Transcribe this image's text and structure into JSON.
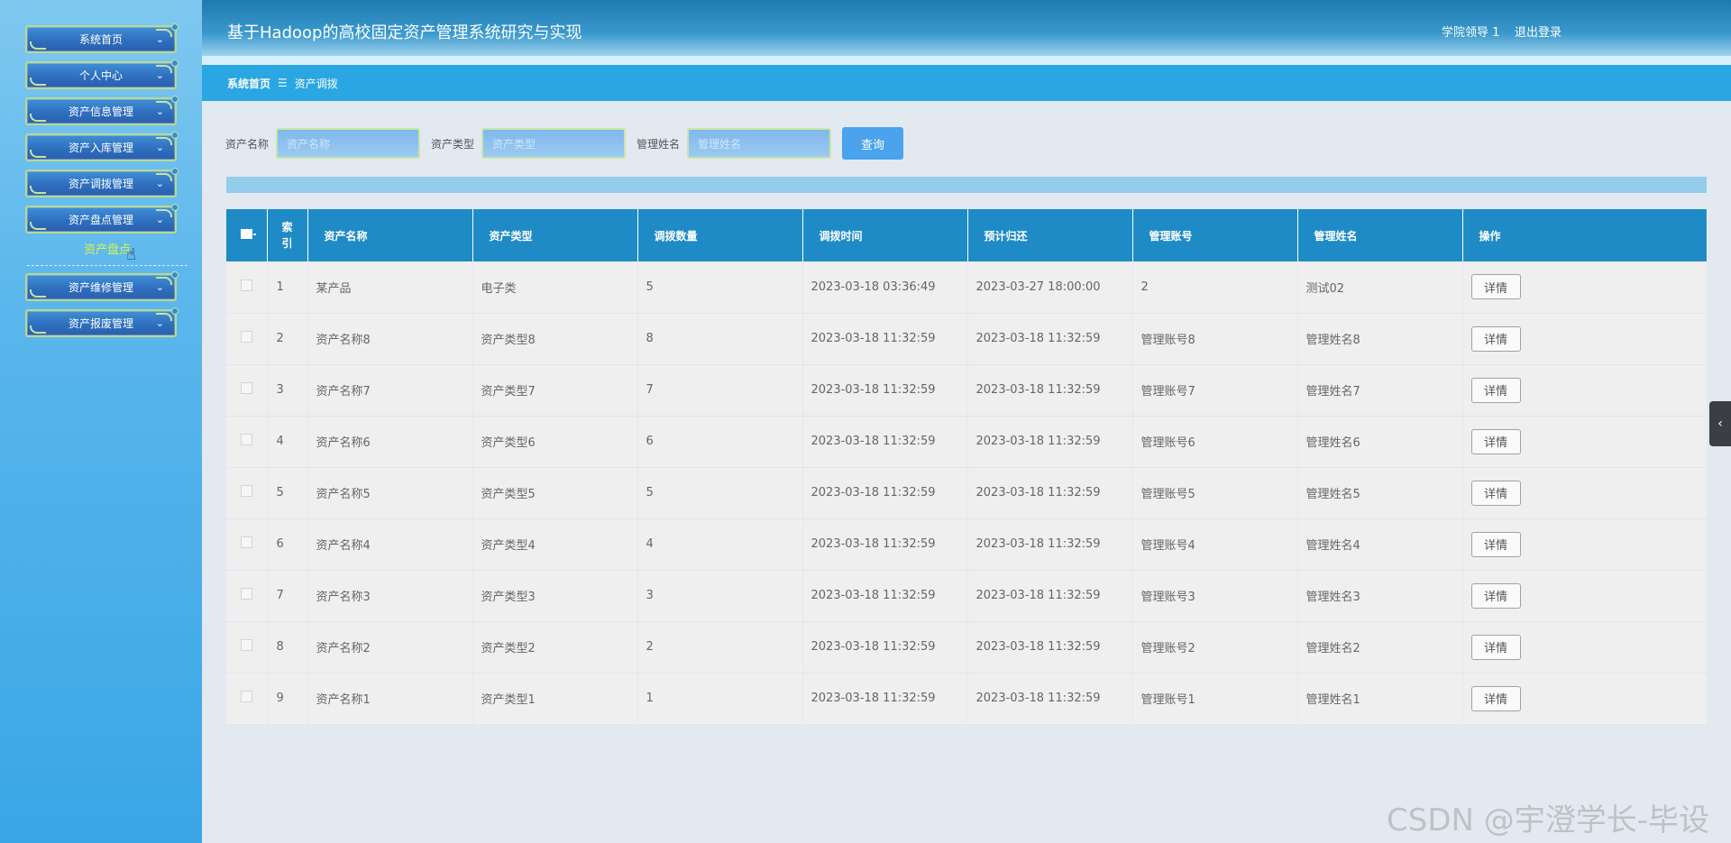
{
  "sidebar": {
    "items": [
      {
        "label": "系统首页"
      },
      {
        "label": "个人中心"
      },
      {
        "label": "资产信息管理"
      },
      {
        "label": "资产入库管理"
      },
      {
        "label": "资产调拨管理"
      },
      {
        "label": "资产盘点管理"
      },
      {
        "label": "资产维修管理"
      },
      {
        "label": "资产报废管理"
      }
    ],
    "submenu_label": "资产盘点",
    "chevron": "⌄",
    "cursor_icon": "☝"
  },
  "header": {
    "title": "基于Hadoop的高校固定资产管理系统研究与实现",
    "user": "学院领导 1",
    "logout": "退出登录"
  },
  "breadcrumb": {
    "home": "系统首页",
    "separator": "☰",
    "current": "资产调拨"
  },
  "search": {
    "asset_name_label": "资产名称",
    "asset_name_placeholder": "资产名称",
    "asset_type_label": "资产类型",
    "asset_type_placeholder": "资产类型",
    "manager_name_label": "管理姓名",
    "manager_name_placeholder": "管理姓名",
    "query_button": "查询"
  },
  "table": {
    "columns": [
      "索引",
      "资产名称",
      "资产类型",
      "调拨数量",
      "调拨时间",
      "预计归还",
      "管理账号",
      "管理姓名",
      "操作"
    ],
    "index_header_line1": "索",
    "index_header_line2": "引",
    "detail_label": "详情",
    "rows": [
      [
        "1",
        "某产品",
        "电子类",
        "5",
        "2023-03-18 03:36:49",
        "2023-03-27 18:00:00",
        "2",
        "测试02"
      ],
      [
        "2",
        "资产名称8",
        "资产类型8",
        "8",
        "2023-03-18 11:32:59",
        "2023-03-18 11:32:59",
        "管理账号8",
        "管理姓名8"
      ],
      [
        "3",
        "资产名称7",
        "资产类型7",
        "7",
        "2023-03-18 11:32:59",
        "2023-03-18 11:32:59",
        "管理账号7",
        "管理姓名7"
      ],
      [
        "4",
        "资产名称6",
        "资产类型6",
        "6",
        "2023-03-18 11:32:59",
        "2023-03-18 11:32:59",
        "管理账号6",
        "管理姓名6"
      ],
      [
        "5",
        "资产名称5",
        "资产类型5",
        "5",
        "2023-03-18 11:32:59",
        "2023-03-18 11:32:59",
        "管理账号5",
        "管理姓名5"
      ],
      [
        "6",
        "资产名称4",
        "资产类型4",
        "4",
        "2023-03-18 11:32:59",
        "2023-03-18 11:32:59",
        "管理账号4",
        "管理姓名4"
      ],
      [
        "7",
        "资产名称3",
        "资产类型3",
        "3",
        "2023-03-18 11:32:59",
        "2023-03-18 11:32:59",
        "管理账号3",
        "管理姓名3"
      ],
      [
        "8",
        "资产名称2",
        "资产类型2",
        "2",
        "2023-03-18 11:32:59",
        "2023-03-18 11:32:59",
        "管理账号2",
        "管理姓名2"
      ],
      [
        "9",
        "资产名称1",
        "资产类型1",
        "1",
        "2023-03-18 11:32:59",
        "2023-03-18 11:32:59",
        "管理账号1",
        "管理姓名1"
      ]
    ]
  },
  "side_toggle_icon": "‹",
  "watermark": "CSDN @宇澄学长-毕设",
  "colors": {
    "header": "#1e7ab0",
    "breadcrumb": "#2aa7e2",
    "table_header": "#1f8bc6",
    "submenu": "#d7f44a"
  }
}
